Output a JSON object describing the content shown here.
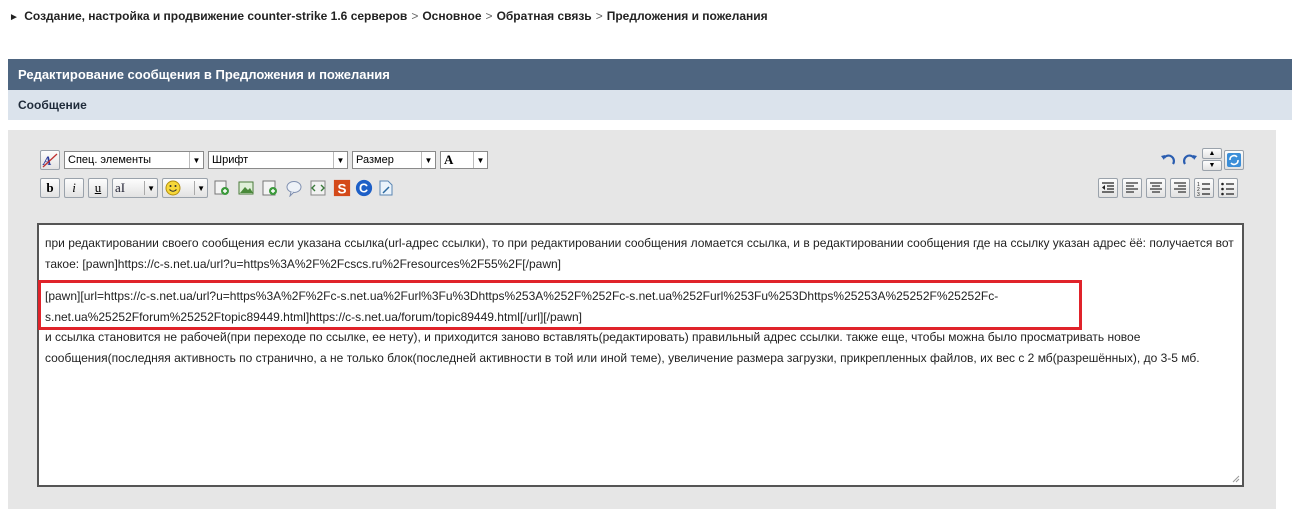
{
  "breadcrumb": {
    "items": [
      "Создание, настройка и продвижение counter-strike 1.6 серверов",
      "Основное",
      "Обратная связь",
      "Предложения и пожелания"
    ],
    "separator": ">"
  },
  "panel": {
    "title": "Редактирование сообщения в Предложения и пожелания",
    "subtitle": "Сообщение"
  },
  "toolbar": {
    "special_select": "Спец. элементы",
    "font_select": "Шрифт",
    "size_select": "Размер",
    "color_label": "A",
    "bold": "b",
    "italic": "i",
    "underline": "u",
    "font_style_label": "aI"
  },
  "editor": {
    "para1": "при редактировании своего сообщения если указана ссылка(url-адрес ссылки), то при редактировании сообщения ломается ссылка, и в редактировании сообщения где на ссылку указан адрес ёё: получается вот такое: [pawn]https://c-s.net.ua/url?u=https%3A%2F%2Fcscs.ru%2Fresources%2F55%2F[/pawn]",
    "para2": "[pawn][url=https://c-s.net.ua/url?u=https%3A%2F%2Fc-s.net.ua%2Furl%3Fu%3Dhttps%253A%252F%252Fc-s.net.ua%252Furl%253Fu%253Dhttps%25253A%25252F%25252Fc-s.net.ua%25252Fforum%25252Ftopic89449.html]https://c-s.net.ua/forum/topic89449.html[/url][/pawn]",
    "para3": "и ссылка становится не рабочей(при переходе по ссылке, ее нету), и приходится заново вставлять(редактировать) правильный адрес ссылки. также еще, чтобы можна было просматривать новое сообщения(последняя активность по странично, а не только блок(последней активности в той или иной теме), увеличение размера загрузки, прикрепленных файлов, их вес с 2 мб(разрешённых), до 3-5 мб."
  },
  "colors": {
    "header_bg": "#4e6580",
    "sub_bg": "#dbe3ec",
    "body_bg": "#e6e6e6",
    "highlight": "#e0232a"
  }
}
